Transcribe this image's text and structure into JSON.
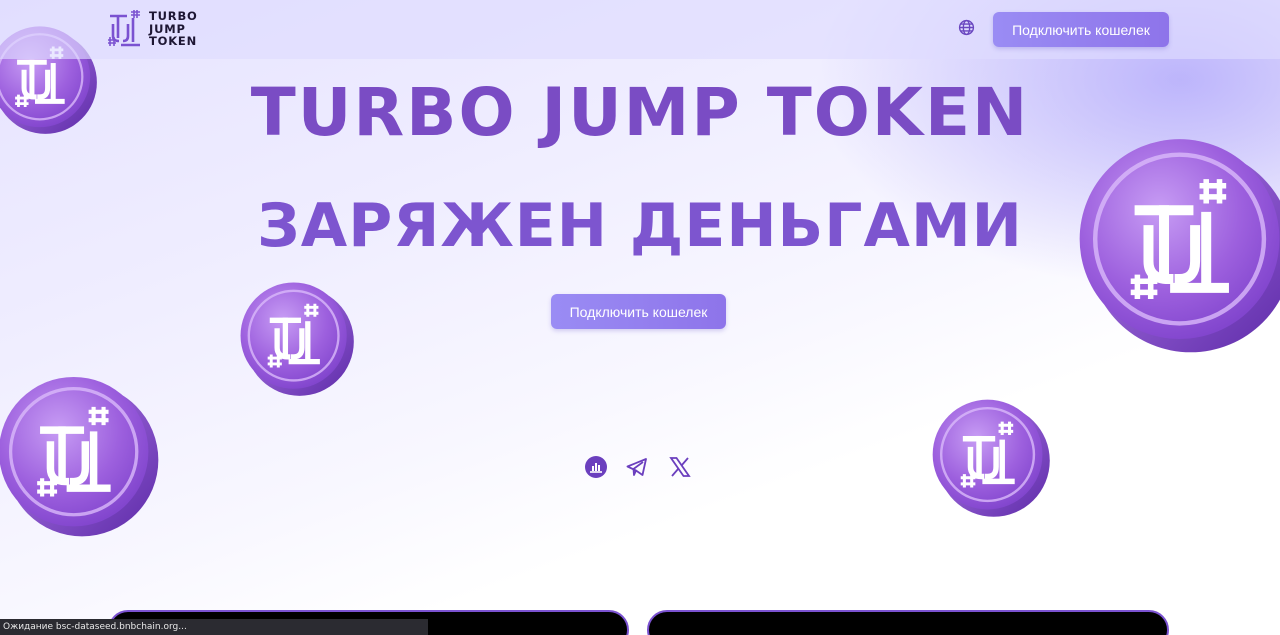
{
  "brand": {
    "name_lines": [
      "TURBO",
      "JUMP",
      "TOKEN"
    ],
    "accent_color": "#7b52d1"
  },
  "header": {
    "language_icon": "globe-icon",
    "connect_wallet_label": "Подключить кошелек"
  },
  "hero": {
    "title": "TURBO JUMP TOKEN",
    "subtitle": "ЗАРЯЖЕН ДЕНЬГАМИ",
    "connect_wallet_label": "Подключить кошелек"
  },
  "social": {
    "icons": [
      "chart-icon",
      "telegram-icon",
      "x-icon"
    ]
  },
  "decor": {
    "coin_icon": "token-coin-icon"
  },
  "statusbar": {
    "text": "Ожидание bsc-dataseed.bnbchain.org..."
  }
}
